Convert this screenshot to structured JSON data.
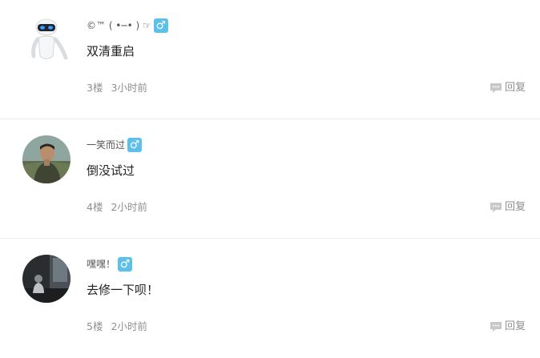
{
  "replies": [
    {
      "username": "©™ ( •─• ) ☞",
      "gender": "♂",
      "content": "双清重启",
      "floor": "3楼",
      "time": "3小时前",
      "reply_label": "回复"
    },
    {
      "username": "一笑而过",
      "gender": "♂",
      "content": "倒没试过",
      "floor": "4楼",
      "time": "2小时前",
      "reply_label": "回复"
    },
    {
      "username": "嘿嘿！",
      "gender": "♂",
      "content": "去修一下呗！",
      "floor": "5楼",
      "time": "2小时前",
      "reply_label": "回复"
    }
  ],
  "colors": {
    "gender_badge": "#5bc0eb",
    "meta_text": "#8f8f8f",
    "divider": "#ececec"
  }
}
